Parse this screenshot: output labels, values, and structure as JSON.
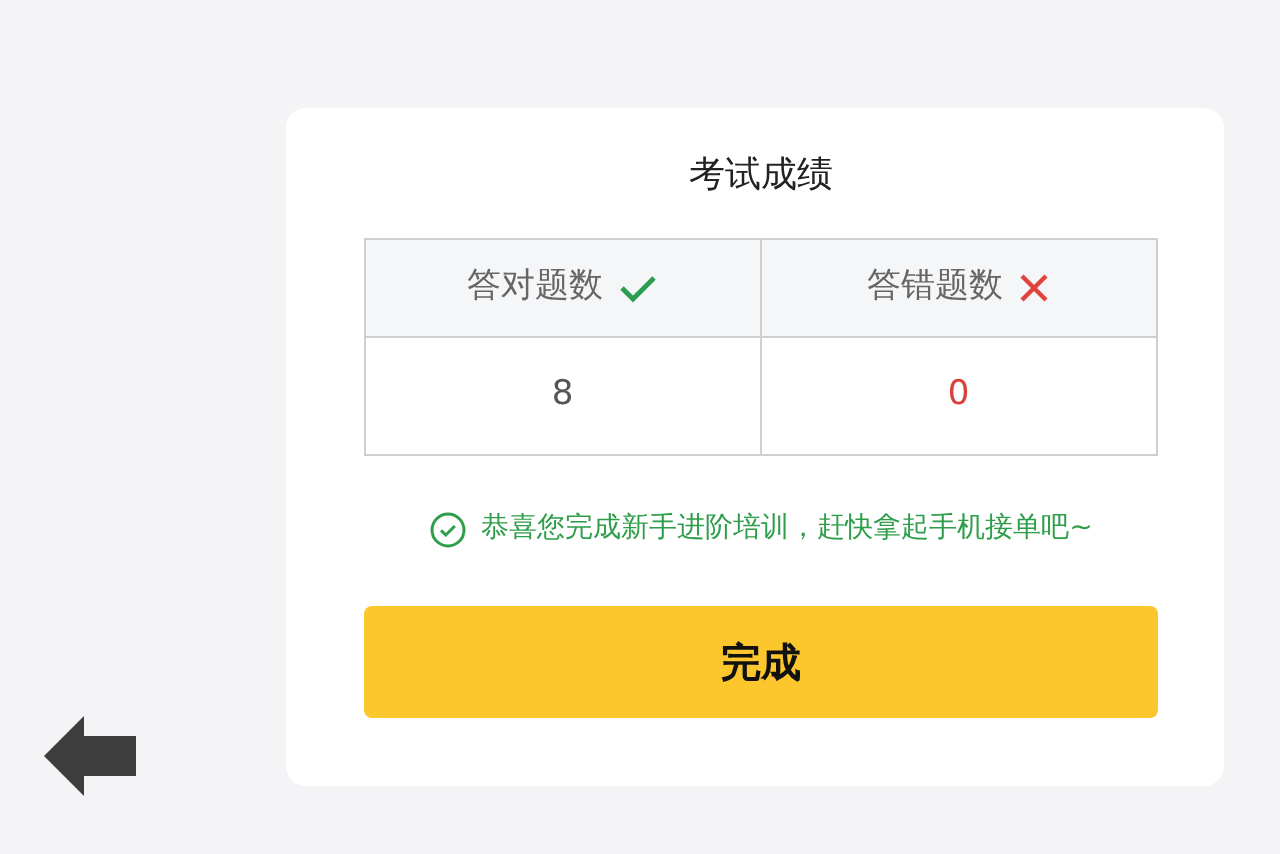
{
  "title": "考试成绩",
  "table": {
    "columns": [
      {
        "label": "答对题数",
        "kind": "correct"
      },
      {
        "label": "答错题数",
        "kind": "wrong"
      }
    ],
    "row": [
      {
        "value": "8",
        "kind": "correct"
      },
      {
        "value": "0",
        "kind": "wrong"
      }
    ]
  },
  "message": "恭喜您完成新手进阶培训，赶快拿起手机接单吧~",
  "button": "完成"
}
